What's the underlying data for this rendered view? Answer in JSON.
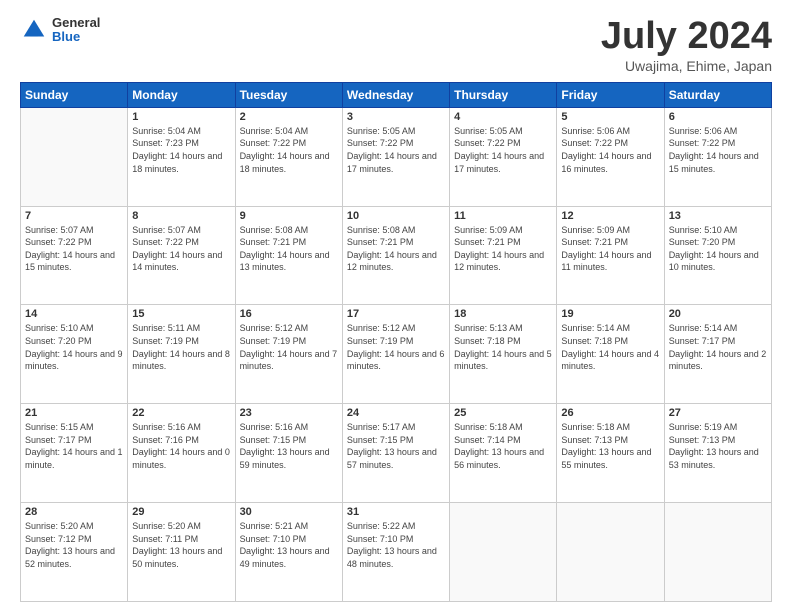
{
  "header": {
    "logo": {
      "general": "General",
      "blue": "Blue"
    },
    "title": "July 2024",
    "location": "Uwajima, Ehime, Japan"
  },
  "weekdays": [
    "Sunday",
    "Monday",
    "Tuesday",
    "Wednesday",
    "Thursday",
    "Friday",
    "Saturday"
  ],
  "weeks": [
    [
      {
        "day": "",
        "sunrise": "",
        "sunset": "",
        "daylight": ""
      },
      {
        "day": "1",
        "sunrise": "Sunrise: 5:04 AM",
        "sunset": "Sunset: 7:23 PM",
        "daylight": "Daylight: 14 hours and 18 minutes."
      },
      {
        "day": "2",
        "sunrise": "Sunrise: 5:04 AM",
        "sunset": "Sunset: 7:22 PM",
        "daylight": "Daylight: 14 hours and 18 minutes."
      },
      {
        "day": "3",
        "sunrise": "Sunrise: 5:05 AM",
        "sunset": "Sunset: 7:22 PM",
        "daylight": "Daylight: 14 hours and 17 minutes."
      },
      {
        "day": "4",
        "sunrise": "Sunrise: 5:05 AM",
        "sunset": "Sunset: 7:22 PM",
        "daylight": "Daylight: 14 hours and 17 minutes."
      },
      {
        "day": "5",
        "sunrise": "Sunrise: 5:06 AM",
        "sunset": "Sunset: 7:22 PM",
        "daylight": "Daylight: 14 hours and 16 minutes."
      },
      {
        "day": "6",
        "sunrise": "Sunrise: 5:06 AM",
        "sunset": "Sunset: 7:22 PM",
        "daylight": "Daylight: 14 hours and 15 minutes."
      }
    ],
    [
      {
        "day": "7",
        "sunrise": "Sunrise: 5:07 AM",
        "sunset": "Sunset: 7:22 PM",
        "daylight": "Daylight: 14 hours and 15 minutes."
      },
      {
        "day": "8",
        "sunrise": "Sunrise: 5:07 AM",
        "sunset": "Sunset: 7:22 PM",
        "daylight": "Daylight: 14 hours and 14 minutes."
      },
      {
        "day": "9",
        "sunrise": "Sunrise: 5:08 AM",
        "sunset": "Sunset: 7:21 PM",
        "daylight": "Daylight: 14 hours and 13 minutes."
      },
      {
        "day": "10",
        "sunrise": "Sunrise: 5:08 AM",
        "sunset": "Sunset: 7:21 PM",
        "daylight": "Daylight: 14 hours and 12 minutes."
      },
      {
        "day": "11",
        "sunrise": "Sunrise: 5:09 AM",
        "sunset": "Sunset: 7:21 PM",
        "daylight": "Daylight: 14 hours and 12 minutes."
      },
      {
        "day": "12",
        "sunrise": "Sunrise: 5:09 AM",
        "sunset": "Sunset: 7:21 PM",
        "daylight": "Daylight: 14 hours and 11 minutes."
      },
      {
        "day": "13",
        "sunrise": "Sunrise: 5:10 AM",
        "sunset": "Sunset: 7:20 PM",
        "daylight": "Daylight: 14 hours and 10 minutes."
      }
    ],
    [
      {
        "day": "14",
        "sunrise": "Sunrise: 5:10 AM",
        "sunset": "Sunset: 7:20 PM",
        "daylight": "Daylight: 14 hours and 9 minutes."
      },
      {
        "day": "15",
        "sunrise": "Sunrise: 5:11 AM",
        "sunset": "Sunset: 7:19 PM",
        "daylight": "Daylight: 14 hours and 8 minutes."
      },
      {
        "day": "16",
        "sunrise": "Sunrise: 5:12 AM",
        "sunset": "Sunset: 7:19 PM",
        "daylight": "Daylight: 14 hours and 7 minutes."
      },
      {
        "day": "17",
        "sunrise": "Sunrise: 5:12 AM",
        "sunset": "Sunset: 7:19 PM",
        "daylight": "Daylight: 14 hours and 6 minutes."
      },
      {
        "day": "18",
        "sunrise": "Sunrise: 5:13 AM",
        "sunset": "Sunset: 7:18 PM",
        "daylight": "Daylight: 14 hours and 5 minutes."
      },
      {
        "day": "19",
        "sunrise": "Sunrise: 5:14 AM",
        "sunset": "Sunset: 7:18 PM",
        "daylight": "Daylight: 14 hours and 4 minutes."
      },
      {
        "day": "20",
        "sunrise": "Sunrise: 5:14 AM",
        "sunset": "Sunset: 7:17 PM",
        "daylight": "Daylight: 14 hours and 2 minutes."
      }
    ],
    [
      {
        "day": "21",
        "sunrise": "Sunrise: 5:15 AM",
        "sunset": "Sunset: 7:17 PM",
        "daylight": "Daylight: 14 hours and 1 minute."
      },
      {
        "day": "22",
        "sunrise": "Sunrise: 5:16 AM",
        "sunset": "Sunset: 7:16 PM",
        "daylight": "Daylight: 14 hours and 0 minutes."
      },
      {
        "day": "23",
        "sunrise": "Sunrise: 5:16 AM",
        "sunset": "Sunset: 7:15 PM",
        "daylight": "Daylight: 13 hours and 59 minutes."
      },
      {
        "day": "24",
        "sunrise": "Sunrise: 5:17 AM",
        "sunset": "Sunset: 7:15 PM",
        "daylight": "Daylight: 13 hours and 57 minutes."
      },
      {
        "day": "25",
        "sunrise": "Sunrise: 5:18 AM",
        "sunset": "Sunset: 7:14 PM",
        "daylight": "Daylight: 13 hours and 56 minutes."
      },
      {
        "day": "26",
        "sunrise": "Sunrise: 5:18 AM",
        "sunset": "Sunset: 7:13 PM",
        "daylight": "Daylight: 13 hours and 55 minutes."
      },
      {
        "day": "27",
        "sunrise": "Sunrise: 5:19 AM",
        "sunset": "Sunset: 7:13 PM",
        "daylight": "Daylight: 13 hours and 53 minutes."
      }
    ],
    [
      {
        "day": "28",
        "sunrise": "Sunrise: 5:20 AM",
        "sunset": "Sunset: 7:12 PM",
        "daylight": "Daylight: 13 hours and 52 minutes."
      },
      {
        "day": "29",
        "sunrise": "Sunrise: 5:20 AM",
        "sunset": "Sunset: 7:11 PM",
        "daylight": "Daylight: 13 hours and 50 minutes."
      },
      {
        "day": "30",
        "sunrise": "Sunrise: 5:21 AM",
        "sunset": "Sunset: 7:10 PM",
        "daylight": "Daylight: 13 hours and 49 minutes."
      },
      {
        "day": "31",
        "sunrise": "Sunrise: 5:22 AM",
        "sunset": "Sunset: 7:10 PM",
        "daylight": "Daylight: 13 hours and 48 minutes."
      },
      {
        "day": "",
        "sunrise": "",
        "sunset": "",
        "daylight": ""
      },
      {
        "day": "",
        "sunrise": "",
        "sunset": "",
        "daylight": ""
      },
      {
        "day": "",
        "sunrise": "",
        "sunset": "",
        "daylight": ""
      }
    ]
  ]
}
